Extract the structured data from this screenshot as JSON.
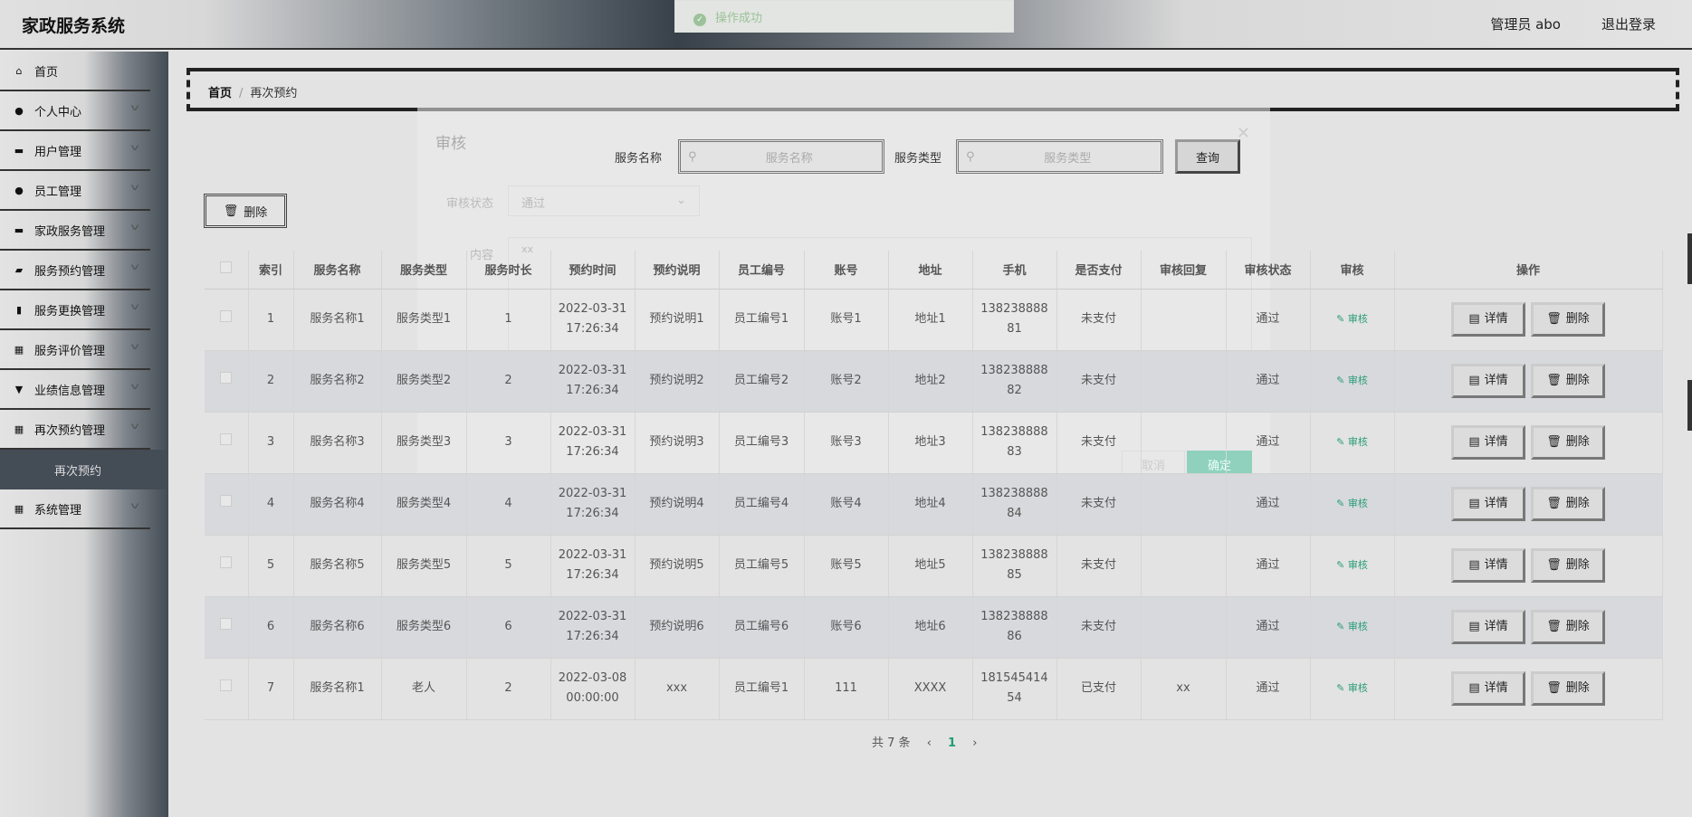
{
  "header": {
    "title": "家政服务系统",
    "user": "管理员 abo",
    "logout": "退出登录"
  },
  "toast": {
    "text": "操作成功"
  },
  "sidebar": {
    "items": [
      {
        "label": "首页",
        "icon": "home-icon",
        "glyph": "⌂",
        "chev": false
      },
      {
        "label": "个人中心",
        "icon": "user-icon",
        "glyph": "●",
        "chev": true
      },
      {
        "label": "用户管理",
        "icon": "briefcase-icon",
        "glyph": "▬",
        "chev": true
      },
      {
        "label": "员工管理",
        "icon": "pin-icon",
        "glyph": "●",
        "chev": true
      },
      {
        "label": "家政服务管理",
        "icon": "chat-icon",
        "glyph": "▬",
        "chev": true
      },
      {
        "label": "服务预约管理",
        "icon": "car-icon",
        "glyph": "▰",
        "chev": true
      },
      {
        "label": "服务更换管理",
        "icon": "clipboard-icon",
        "glyph": "▮",
        "chev": true
      },
      {
        "label": "服务评价管理",
        "icon": "grid-icon",
        "glyph": "▦",
        "chev": true
      },
      {
        "label": "业绩信息管理",
        "icon": "trophy-icon",
        "glyph": "▼",
        "chev": true
      },
      {
        "label": "再次预约管理",
        "icon": "grid-icon",
        "glyph": "▦",
        "chev": true
      }
    ],
    "sub": "再次预约",
    "last": {
      "label": "系统管理",
      "icon": "grid-icon",
      "glyph": "▦"
    }
  },
  "breadcrumb": {
    "home": "首页",
    "current": "再次预约"
  },
  "toolbar": {
    "delete": "删除"
  },
  "modal": {
    "title": "审核",
    "status_label": "审核状态",
    "status_value": "通过",
    "content_label": "内容",
    "content_value": "xx",
    "cancel": "取消",
    "confirm": "确定"
  },
  "search": {
    "name_label": "服务名称",
    "name_placeholder": "服务名称",
    "type_label": "服务类型",
    "type_placeholder": "服务类型",
    "query": "查询"
  },
  "table": {
    "headers": [
      "索引",
      "服务名称",
      "服务类型",
      "服务时长",
      "预约时间",
      "预约说明",
      "员工编号",
      "账号",
      "地址",
      "手机",
      "是否支付",
      "审核回复",
      "审核状态",
      "审核",
      "操作"
    ],
    "audit_label": "审核",
    "detail_label": "详情",
    "delete_label": "删除",
    "rows": [
      [
        "1",
        "服务名称1",
        "服务类型1",
        "1",
        "2022-03-31 17:26:34",
        "预约说明1",
        "员工编号1",
        "账号1",
        "地址1",
        "13823888881",
        "未支付",
        "",
        "通过"
      ],
      [
        "2",
        "服务名称2",
        "服务类型2",
        "2",
        "2022-03-31 17:26:34",
        "预约说明2",
        "员工编号2",
        "账号2",
        "地址2",
        "13823888882",
        "未支付",
        "",
        "通过"
      ],
      [
        "3",
        "服务名称3",
        "服务类型3",
        "3",
        "2022-03-31 17:26:34",
        "预约说明3",
        "员工编号3",
        "账号3",
        "地址3",
        "13823888883",
        "未支付",
        "",
        "通过"
      ],
      [
        "4",
        "服务名称4",
        "服务类型4",
        "4",
        "2022-03-31 17:26:34",
        "预约说明4",
        "员工编号4",
        "账号4",
        "地址4",
        "13823888884",
        "未支付",
        "",
        "通过"
      ],
      [
        "5",
        "服务名称5",
        "服务类型5",
        "5",
        "2022-03-31 17:26:34",
        "预约说明5",
        "员工编号5",
        "账号5",
        "地址5",
        "13823888885",
        "未支付",
        "",
        "通过"
      ],
      [
        "6",
        "服务名称6",
        "服务类型6",
        "6",
        "2022-03-31 17:26:34",
        "预约说明6",
        "员工编号6",
        "账号6",
        "地址6",
        "13823888886",
        "未支付",
        "",
        "通过"
      ],
      [
        "7",
        "服务名称1",
        "老人",
        "2",
        "2022-03-08 00:00:00",
        "xxx",
        "员工编号1",
        "111",
        "XXXX",
        "18154541454",
        "已支付",
        "xx",
        "通过"
      ]
    ]
  },
  "pagination": {
    "total": "共 7 条",
    "current": "1"
  }
}
